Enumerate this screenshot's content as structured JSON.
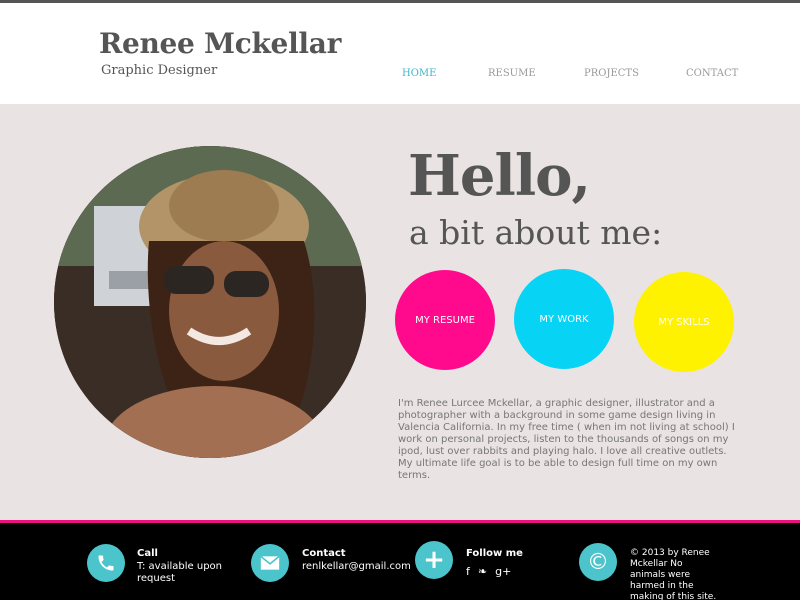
{
  "brand": {
    "name": "Renee Mckellar",
    "subtitle": "Graphic Designer"
  },
  "nav": [
    "HOME",
    "RESUME",
    "PROJECTS",
    "CONTACT"
  ],
  "hero": {
    "hello": "Hello,",
    "subtitle": "a bit about me:"
  },
  "buttons": [
    "MY RESUME",
    "MY WORK",
    "MY SKILLS"
  ],
  "bio": "I'm Renee Lurcee Mckellar, a graphic designer, illustrator and a photographer with a background in some game design living in Valencia California. In my free time ( when im not living at school) I work on personal projects, listen to the thousands of songs on my ipod, lust over rabbits and playing halo. I love all creative outlets. My ultimate life goal is to be able to design full time on my own terms.",
  "footer": {
    "call": {
      "title": "Call",
      "text": "T: available upon request"
    },
    "contact": {
      "title": "Contact",
      "text": "renlkellar@gmail.com"
    },
    "follow": {
      "title": "Follow me",
      "social": [
        "f",
        "❧",
        "g+"
      ]
    },
    "copyright": "© 2013 by Renee Mckellar No animals were harmed in the making of this site."
  },
  "colors": {
    "accent": "#3fb5c8",
    "pink": "#ff0a8c",
    "cyan": "#07d3f5",
    "yellow": "#fff200",
    "footer_icon": "#4cc4cb",
    "footer_line": "#e8127c"
  }
}
